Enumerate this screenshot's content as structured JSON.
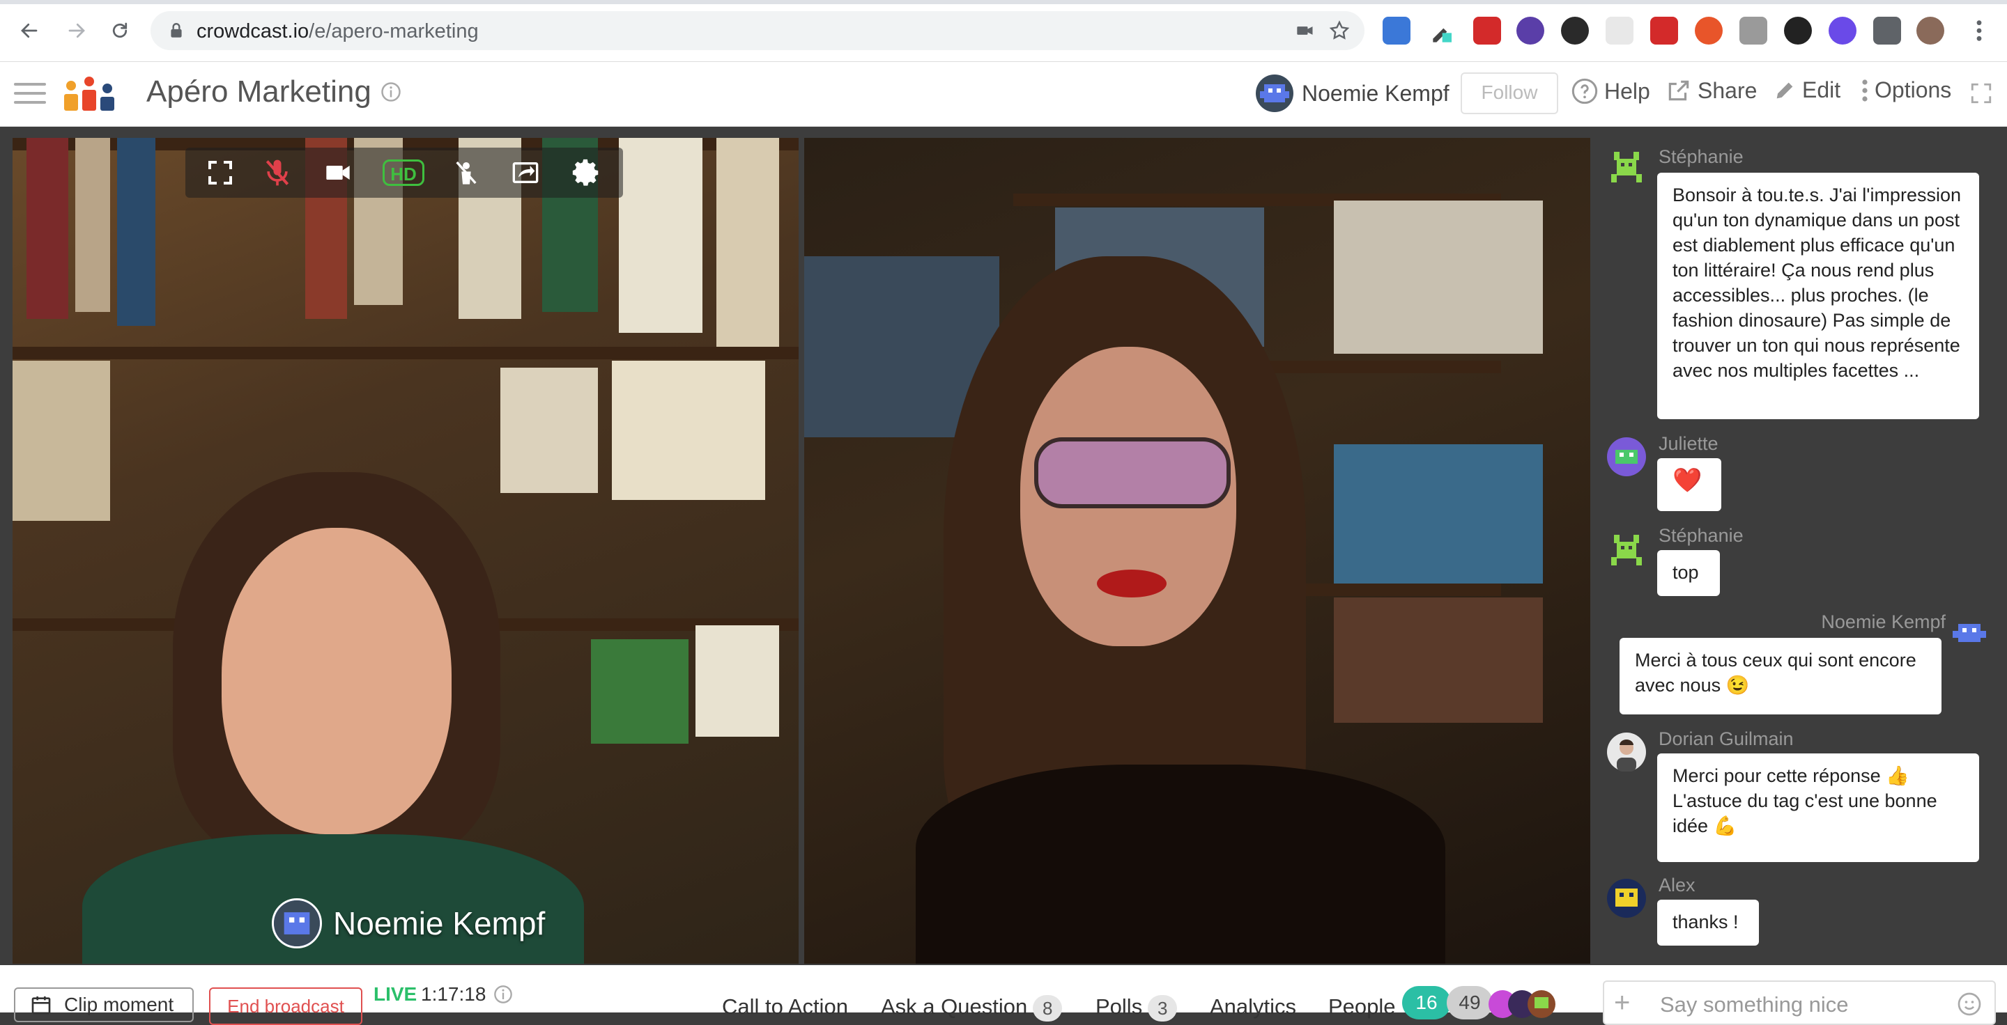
{
  "browser": {
    "url_host": "crowdcast.io",
    "url_path": "/e/apero-marketing"
  },
  "header": {
    "event_title": "Apéro Marketing",
    "host_name": "Noemie Kempf",
    "follow_label": "Follow",
    "help_label": "Help",
    "share_label": "Share",
    "edit_label": "Edit",
    "options_label": "Options"
  },
  "video": {
    "speaker_left_name": "Noemie Kempf",
    "hd_label": "HD"
  },
  "chat": {
    "messages": [
      {
        "author": "Stéphanie",
        "text": "Bonsoir à tou.te.s. J'ai l'impression qu'un ton dynamique dans un post est diablement plus efficace qu'un ton littéraire! Ça nous rend plus accessibles... plus proches. (le fashion dinosaure) Pas simple de trouver un ton qui nous représente avec nos multiples facettes ..."
      },
      {
        "author": "Juliette",
        "text": "❤️"
      },
      {
        "author": "Stéphanie",
        "text": "top"
      },
      {
        "author": "Noemie Kempf",
        "text": "Merci à tous ceux qui sont encore avec nous 😉"
      },
      {
        "author": "Dorian Guilmain",
        "text": "Merci pour cette réponse 👍 L'astuce du tag c'est une bonne idée 💪"
      },
      {
        "author": "Alex",
        "text": "thanks !"
      }
    ],
    "input_placeholder": "Say something nice"
  },
  "bottombar": {
    "clip_label": "Clip moment",
    "end_label": "End broadcast",
    "live_label": "LIVE",
    "live_time": "1:17:18",
    "tabs": {
      "cta": "Call to Action",
      "ask": "Ask a Question",
      "ask_count": "8",
      "polls": "Polls",
      "polls_count": "3",
      "analytics": "Analytics",
      "people": "People",
      "people_live": "16",
      "people_total": "49"
    }
  },
  "colors": {
    "live_green": "#2bbf6a",
    "end_red": "#e05050",
    "people_teal": "#2bbfa5",
    "hd_green": "#3fbf3f",
    "mic_muted_red": "#e0404a"
  }
}
